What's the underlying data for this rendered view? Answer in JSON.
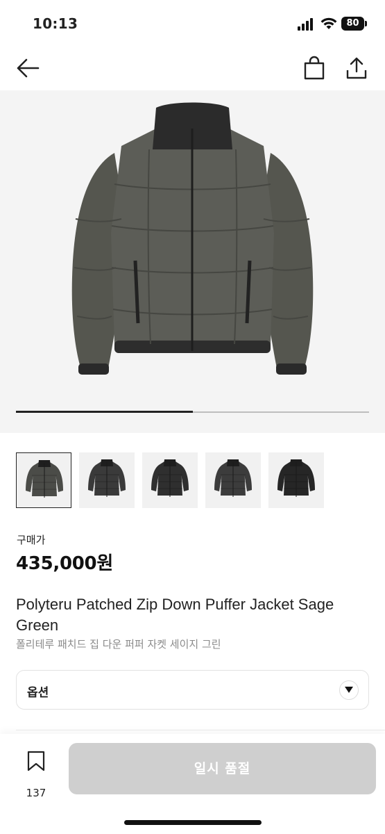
{
  "status_bar": {
    "time": "10:13",
    "battery": "80"
  },
  "product": {
    "price_label": "구매가",
    "price": "435,000원",
    "title": "Polyteru Patched Zip Down Puffer Jacket Sage Green",
    "subtitle": "폴리테루 패치드 집 다운 퍼퍼 자켓 세이지 그린",
    "image_progress": 0.5
  },
  "thumbnails": [
    {
      "name": "thumb-1",
      "color": "#4b4c48",
      "selected": true
    },
    {
      "name": "thumb-2",
      "color": "#3a3a3a",
      "selected": false
    },
    {
      "name": "thumb-3",
      "color": "#2f2f2f",
      "selected": false
    },
    {
      "name": "thumb-4",
      "color": "#3c3c3c",
      "selected": false
    },
    {
      "name": "thumb-5",
      "color": "#262626",
      "selected": false
    }
  ],
  "option": {
    "label": "옵션"
  },
  "bottom_bar": {
    "bookmark_count": "137",
    "action_label": "일시 품절"
  },
  "colors": {
    "jacket": "#5a5b56",
    "button_disabled": "#cfcfcf"
  },
  "icons": [
    "back-arrow-icon",
    "shopping-bag-icon",
    "share-icon",
    "chevron-down-icon",
    "bookmark-icon"
  ]
}
